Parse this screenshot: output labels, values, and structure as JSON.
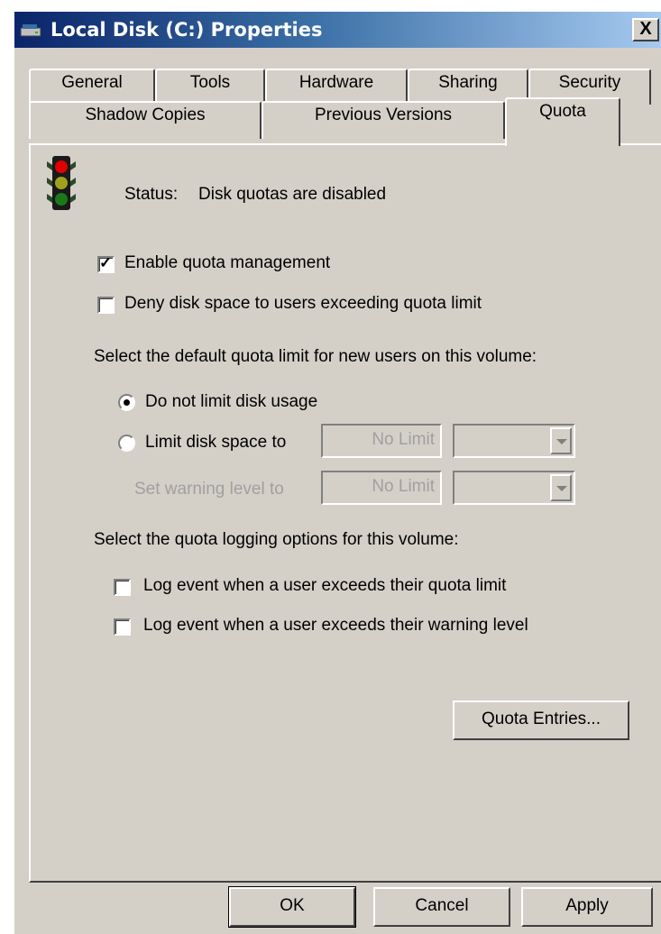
{
  "window": {
    "title": "Local Disk (C:) Properties",
    "close_glyph": "X"
  },
  "tabs_row1": [
    "General",
    "Tools",
    "Hardware",
    "Sharing",
    "Security"
  ],
  "tabs_row2": [
    "Shadow Copies",
    "Previous Versions",
    "Quota"
  ],
  "active_tab": "Quota",
  "status": {
    "label": "Status:",
    "text": "Disk quotas are disabled",
    "icon": "traffic-light-icon"
  },
  "options": {
    "enable_quota": {
      "label": "Enable quota management",
      "checked": true
    },
    "deny_space": {
      "label": "Deny disk space to users exceeding quota limit",
      "checked": false
    }
  },
  "default_limit": {
    "heading": "Select the default quota limit for new users on this volume:",
    "no_limit_label": "Do not limit disk usage",
    "limit_label": "Limit disk space to",
    "limit_value": "No Limit",
    "warning_label": "Set warning level to",
    "warning_value": "No Limit",
    "selected": "no_limit"
  },
  "logging": {
    "heading": "Select the quota logging options for this volume:",
    "log_limit_label": "Log event when a user exceeds their quota limit",
    "log_warning_label": "Log event when a user exceeds their warning level"
  },
  "buttons": {
    "quota_entries": "Quota Entries...",
    "ok": "OK",
    "cancel": "Cancel",
    "apply": "Apply"
  }
}
